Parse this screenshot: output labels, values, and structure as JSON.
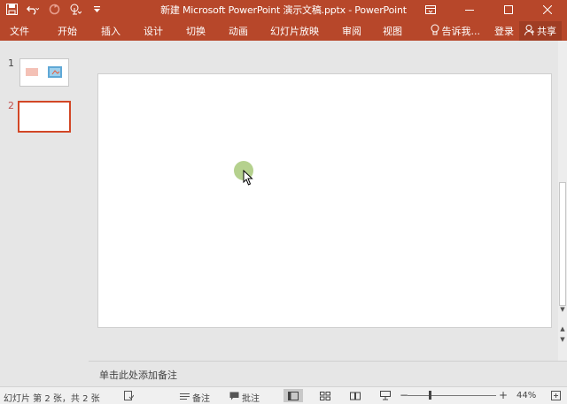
{
  "titlebar": {
    "title": "新建 Microsoft PowerPoint 演示文稿.pptx - PowerPoint",
    "qat_icons": [
      "save-icon",
      "undo-icon",
      "redo-icon",
      "touch-mode-icon",
      "customize-qat-icon"
    ],
    "window_buttons": [
      "ribbon-display-options-icon",
      "minimize-icon",
      "maximize-icon",
      "close-icon"
    ]
  },
  "ribbon": {
    "tabs": [
      "文件",
      "开始",
      "插入",
      "设计",
      "切换",
      "动画",
      "幻灯片放映",
      "审阅",
      "视图"
    ],
    "tell_me": "告诉我...",
    "login": "登录",
    "share": "共享"
  },
  "thumbnails": [
    {
      "number": "1",
      "active": false
    },
    {
      "number": "2",
      "active": true
    }
  ],
  "notes": {
    "placeholder": "单击此处添加备注"
  },
  "status": {
    "slide_info": "幻灯片 第 2 张，共 2 张",
    "notes_label": "备注",
    "comments_label": "批注",
    "zoom_minus": "−",
    "zoom_plus": "+",
    "zoom_level": "44%",
    "zoom_fraction": 0.44
  },
  "colors": {
    "accent": "#b7472a",
    "thumb_active_border": "#d24726"
  }
}
